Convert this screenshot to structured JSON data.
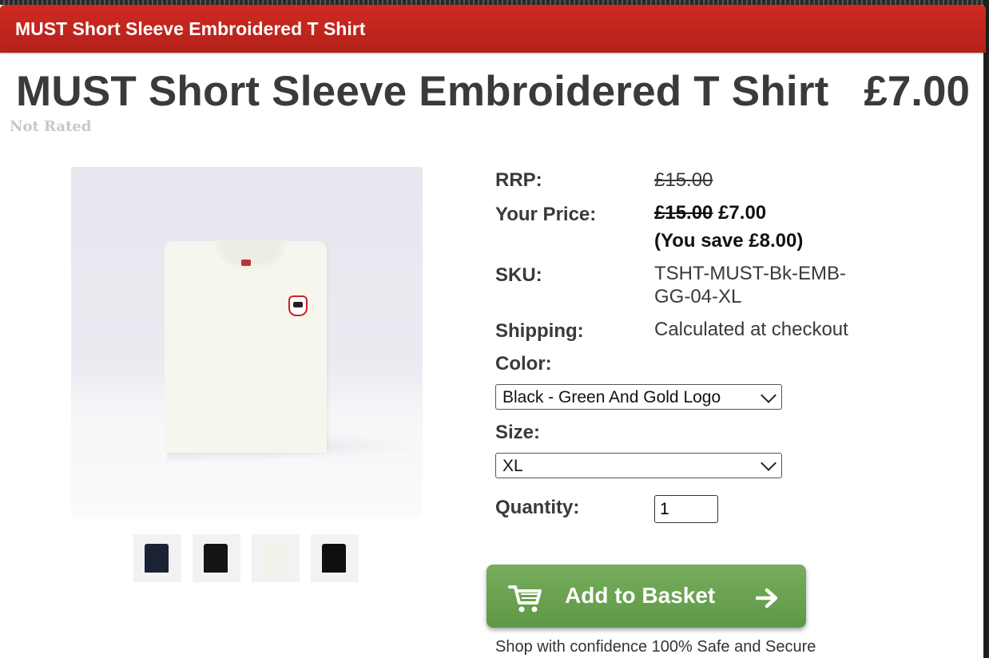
{
  "banner": {
    "title": "MUST Short Sleeve Embroidered T Shirt"
  },
  "product": {
    "title": "MUST Short Sleeve Embroidered T Shirt",
    "price": "£7.00",
    "rating": "Not Rated"
  },
  "gallery": {
    "thumbnails": [
      {
        "color": "#1b2233"
      },
      {
        "color": "#141414"
      },
      {
        "color": "#f3f2ea"
      },
      {
        "color": "#0f0f0f"
      }
    ]
  },
  "details": {
    "rrp_label": "RRP:",
    "rrp_value": "£15.00",
    "your_price_label": "Your Price:",
    "your_price_old": "£15.00",
    "your_price_new": "£7.00",
    "you_save": "(You save £8.00)",
    "sku_label": "SKU:",
    "sku_value_line1": "TSHT-MUST-Bk-EMB-",
    "sku_value_line2": "GG-04-XL",
    "shipping_label": "Shipping:",
    "shipping_value": "Calculated at checkout",
    "color_label": "Color:",
    "color_selected": "Black - Green And Gold Logo",
    "size_label": "Size:",
    "size_selected": "XL",
    "quantity_label": "Quantity:",
    "quantity_value": "1"
  },
  "basket": {
    "label": "Add to Basket",
    "color": "#6aa351"
  },
  "footer": {
    "confidence": "Shop with confidence 100% Safe and Secure"
  },
  "colors": {
    "banner": "#c0241b",
    "text": "#3a3a3a"
  }
}
